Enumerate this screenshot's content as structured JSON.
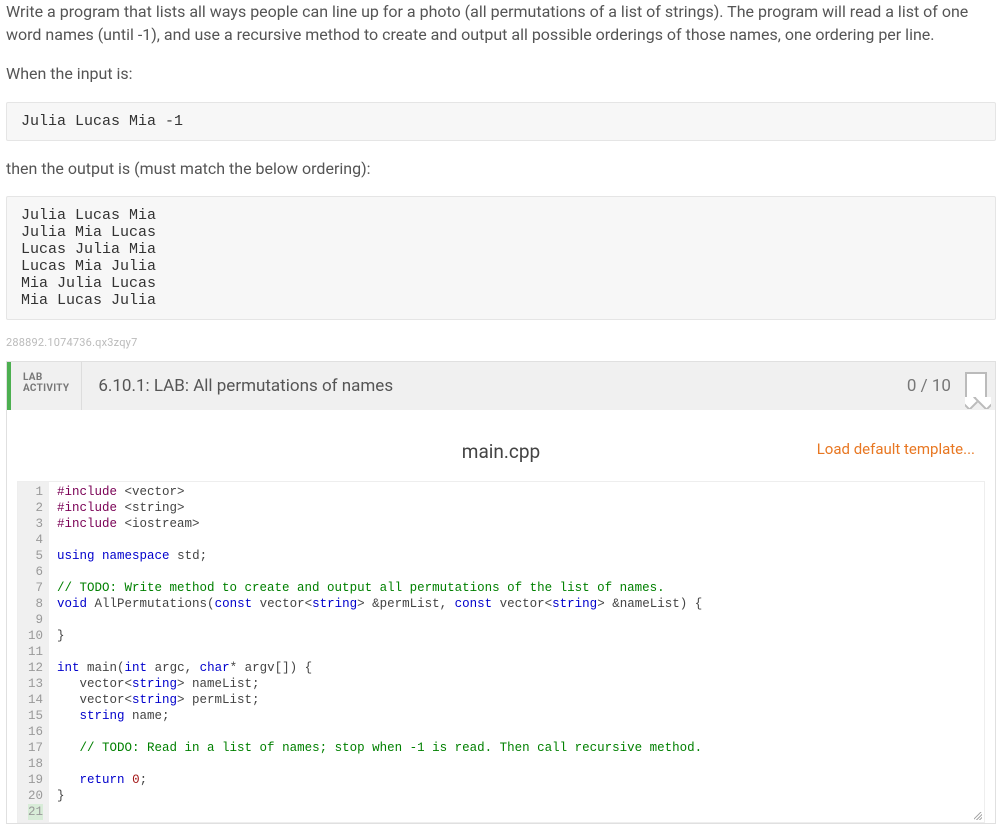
{
  "prompt": {
    "p1": "Write a program that lists all ways people can line up for a photo (all permutations of a list of strings). The program will read a list of one word names (until -1), and use a recursive method to create and output all possible orderings of those names, one ordering per line.",
    "p2": "When the input is:",
    "input_example": "Julia Lucas Mia -1",
    "p3": "then the output is (must match the below ordering):",
    "output_example": "Julia Lucas Mia\nJulia Mia Lucas\nLucas Julia Mia\nLucas Mia Julia\nMia Julia Lucas\nMia Lucas Julia"
  },
  "hash": "288892.1074736.qx3zqy7",
  "lab": {
    "tag_line1": "LAB",
    "tag_line2": "ACTIVITY",
    "title": "6.10.1: LAB: All permutations of names",
    "score": "0 / 10"
  },
  "editor": {
    "filename": "main.cpp",
    "load_template_label": "Load default template...",
    "line_count": 21,
    "code_lines": [
      {
        "n": 1,
        "segs": [
          {
            "t": "#include",
            "c": "pp"
          },
          {
            "t": " <vector>",
            "c": ""
          }
        ]
      },
      {
        "n": 2,
        "segs": [
          {
            "t": "#include",
            "c": "pp"
          },
          {
            "t": " <string>",
            "c": ""
          }
        ]
      },
      {
        "n": 3,
        "segs": [
          {
            "t": "#include",
            "c": "pp"
          },
          {
            "t": " <iostream>",
            "c": ""
          }
        ]
      },
      {
        "n": 4,
        "segs": []
      },
      {
        "n": 5,
        "segs": [
          {
            "t": "using",
            "c": "kw"
          },
          {
            "t": " ",
            "c": ""
          },
          {
            "t": "namespace",
            "c": "kw"
          },
          {
            "t": " std;",
            "c": ""
          }
        ]
      },
      {
        "n": 6,
        "segs": []
      },
      {
        "n": 7,
        "segs": [
          {
            "t": "// TODO: Write method to create and output all permutations of the list of names.",
            "c": "cm"
          }
        ]
      },
      {
        "n": 8,
        "segs": [
          {
            "t": "void",
            "c": "kw"
          },
          {
            "t": " AllPermutations(",
            "c": ""
          },
          {
            "t": "const",
            "c": "kw"
          },
          {
            "t": " vector<",
            "c": ""
          },
          {
            "t": "string",
            "c": "kw"
          },
          {
            "t": "> &permList, ",
            "c": ""
          },
          {
            "t": "const",
            "c": "kw"
          },
          {
            "t": " vector<",
            "c": ""
          },
          {
            "t": "string",
            "c": "kw"
          },
          {
            "t": "> &nameList) {",
            "c": ""
          }
        ]
      },
      {
        "n": 9,
        "segs": []
      },
      {
        "n": 10,
        "segs": [
          {
            "t": "}",
            "c": ""
          }
        ]
      },
      {
        "n": 11,
        "segs": []
      },
      {
        "n": 12,
        "segs": [
          {
            "t": "int",
            "c": "kw"
          },
          {
            "t": " main(",
            "c": ""
          },
          {
            "t": "int",
            "c": "kw"
          },
          {
            "t": " argc, ",
            "c": ""
          },
          {
            "t": "char",
            "c": "kw"
          },
          {
            "t": "* argv[]) {",
            "c": ""
          }
        ]
      },
      {
        "n": 13,
        "segs": [
          {
            "t": "   vector<",
            "c": ""
          },
          {
            "t": "string",
            "c": "kw"
          },
          {
            "t": "> nameList;",
            "c": ""
          }
        ]
      },
      {
        "n": 14,
        "segs": [
          {
            "t": "   vector<",
            "c": ""
          },
          {
            "t": "string",
            "c": "kw"
          },
          {
            "t": "> permList;",
            "c": ""
          }
        ]
      },
      {
        "n": 15,
        "segs": [
          {
            "t": "   ",
            "c": ""
          },
          {
            "t": "string",
            "c": "kw"
          },
          {
            "t": " name;",
            "c": ""
          }
        ]
      },
      {
        "n": 16,
        "segs": []
      },
      {
        "n": 17,
        "segs": [
          {
            "t": "   ",
            "c": ""
          },
          {
            "t": "// TODO: Read in a list of names; stop when -1 is read. Then call recursive method.",
            "c": "cm"
          }
        ]
      },
      {
        "n": 18,
        "segs": []
      },
      {
        "n": 19,
        "segs": [
          {
            "t": "   ",
            "c": ""
          },
          {
            "t": "return",
            "c": "kw"
          },
          {
            "t": " ",
            "c": ""
          },
          {
            "t": "0",
            "c": "num"
          },
          {
            "t": ";",
            "c": ""
          }
        ]
      },
      {
        "n": 20,
        "segs": [
          {
            "t": "}",
            "c": ""
          }
        ]
      },
      {
        "n": 21,
        "segs": []
      }
    ]
  }
}
